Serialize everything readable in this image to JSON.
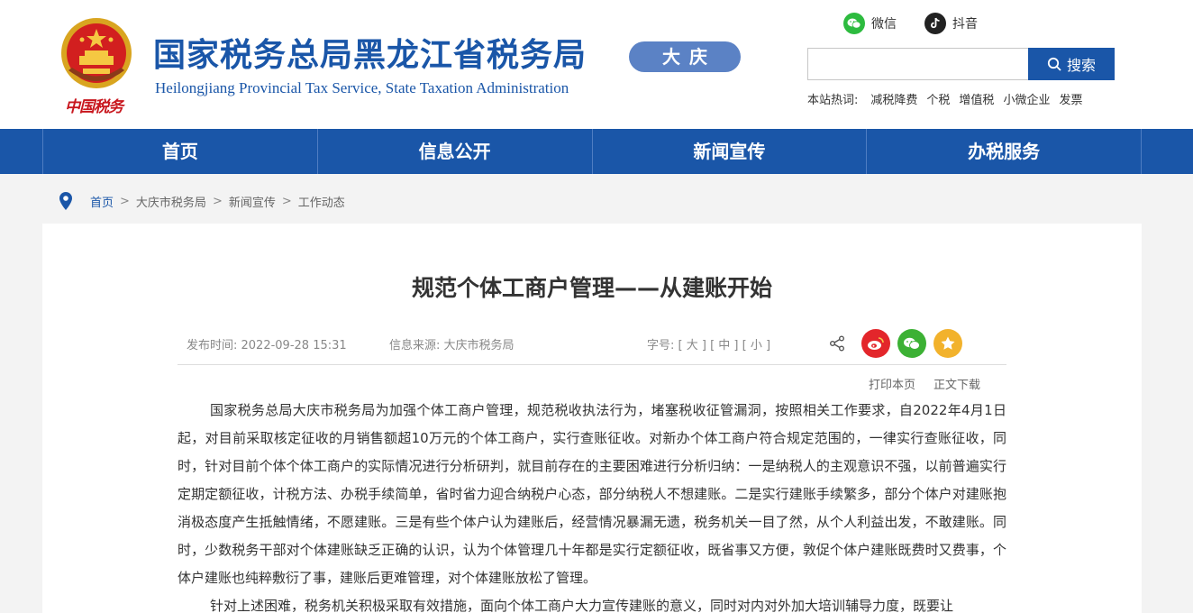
{
  "header": {
    "seal_text": "中国税务",
    "title_cn": "国家税务总局黑龙江省税务局",
    "title_en": "Heilongjiang Provincial Tax Service, State Taxation Administration",
    "city_badge": "大庆",
    "social": [
      {
        "label": "微信",
        "icon": "wechat-icon",
        "color": "#2dbb3f"
      },
      {
        "label": "抖音",
        "icon": "douyin-icon",
        "color": "#222222"
      }
    ],
    "search": {
      "placeholder": "",
      "button_label": "搜索"
    },
    "hot": {
      "label": "本站热词:",
      "items": [
        "减税降费",
        "个税",
        "增值税",
        "小微企业",
        "发票"
      ]
    }
  },
  "nav": {
    "items": [
      "首页",
      "信息公开",
      "新闻宣传",
      "办税服务"
    ]
  },
  "breadcrumb": [
    "首页",
    "大庆市税务局",
    "新闻宣传",
    "工作动态"
  ],
  "article": {
    "title": "规范个体工商户管理——从建账开始",
    "date_label": "发布时间: 2022-09-28 15:31",
    "source_label": "信息来源: 大庆市税务局",
    "font_size_label": "字号:",
    "font_sizes": [
      "[ 大 ]",
      "[ 中 ]",
      "[ 小 ]"
    ],
    "tools": [
      "打印本页",
      "正文下载"
    ],
    "paragraphs": [
      "国家税务总局大庆市税务局为加强个体工商户管理，规范税收执法行为，堵塞税收征管漏洞，按照相关工作要求，自2022年4月1日起，对目前采取核定征收的月销售额超10万元的个体工商户，实行查账征收。对新办个体工商户符合规定范围的，一律实行查账征收，同时，针对目前个体个体工商户的实际情况进行分析研判，就目前存在的主要困难进行分析归纳：一是纳税人的主观意识不强，以前普遍实行定期定额征收，计税方法、办税手续简单，省时省力迎合纳税户心态，部分纳税人不想建账。二是实行建账手续繁多，部分个体户对建账抱消极态度产生抵触情绪，不愿建账。三是有些个体户认为建账后，经营情况暴漏无遗，税务机关一目了然，从个人利益出发，不敢建账。同时，少数税务干部对个体建账缺乏正确的认识，认为个体管理几十年都是实行定额征收，既省事又方便，敦促个体户建账既费时又费事，个体户建账也纯粹敷衍了事，建账后更难管理，对个体建账放松了管理。",
      "针对上述困难，税务机关积极采取有效措施，面向个体工商户大力宣传建账的意义，同时对内对外加大培训辅导力度，既要让"
    ]
  },
  "colors": {
    "brand_blue": "#1a56a8",
    "badge_blue": "#5b82c5",
    "seal_red": "#c8161d"
  }
}
